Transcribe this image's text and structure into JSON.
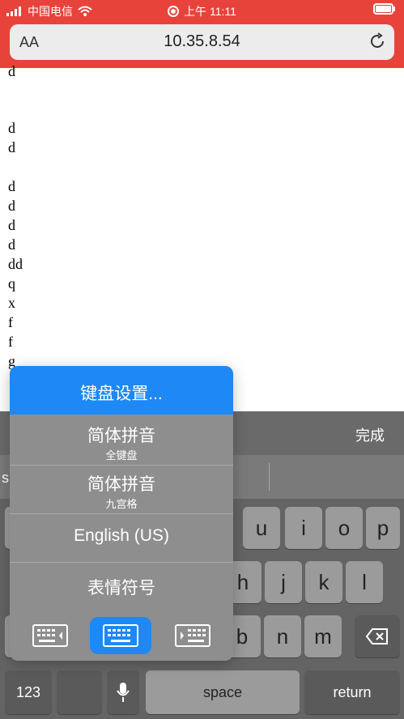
{
  "status": {
    "carrier": "中国电信",
    "time": "上午 11:11"
  },
  "browser": {
    "text_size_label": "AA",
    "url": "10.35.8.54"
  },
  "page": {
    "lines": [
      "d",
      "d",
      "d",
      "d",
      "d",
      "d",
      "d",
      "dd",
      "q",
      "x",
      "f",
      "f",
      "g"
    ]
  },
  "keyboard": {
    "done_label": "完成",
    "candidate_text": "s",
    "row1": [
      "u",
      "i",
      "o",
      "p"
    ],
    "row2": [
      "h",
      "j",
      "k",
      "l"
    ],
    "row3": [
      "b",
      "n",
      "m"
    ],
    "bottom": {
      "numbers_label": "123",
      "space_label": "space",
      "return_label": "return"
    }
  },
  "popup": {
    "header": "键盘设置...",
    "options": [
      {
        "main": "简体拼音",
        "sub": "全键盘"
      },
      {
        "main": "简体拼音",
        "sub": "九宫格"
      },
      {
        "main": "English (US)",
        "sub": ""
      },
      {
        "main": "表情符号",
        "sub": ""
      }
    ]
  },
  "colors": {
    "status_bar": "#e8433b",
    "accent_blue": "#1e88f5"
  }
}
